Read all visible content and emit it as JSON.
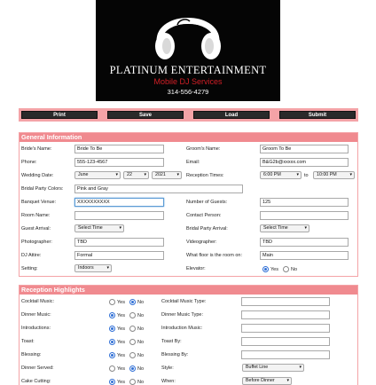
{
  "brand": {
    "name": "PLATINUM ENTERTAINMENT",
    "subtitle": "Mobile DJ Services",
    "phone": "314-556-4279"
  },
  "toolbar": {
    "print": "Print",
    "save": "Save",
    "load": "Load",
    "submit": "Submit"
  },
  "general": {
    "title": "General Information",
    "brides_name_label": "Bride's Name:",
    "brides_name": "Bride To Be",
    "grooms_name_label": "Groom's Name:",
    "grooms_name": "Groom To Be",
    "phone_label": "Phone:",
    "phone": "555-123-4567",
    "email_label": "Email:",
    "email": "B&G2b@xxxxx.com",
    "wedding_date_label": "Wedding Date:",
    "wedding_month": "June",
    "wedding_day": "22",
    "wedding_year": "2021",
    "reception_times_label": "Reception Times:",
    "reception_start": "6:00 PM",
    "to_label": "to",
    "reception_end": "10:00 PM",
    "party_colors_label": "Bridal Party Colors:",
    "party_colors": "Pink and Gray",
    "banquet_venue_label": "Banquet Venue:",
    "banquet_venue": "XXXXXXXXXX",
    "guests_label": "Number of Guests:",
    "guests": "125",
    "room_name_label": "Room Name:",
    "room_name": "",
    "contact_person_label": "Contact Person:",
    "contact_person": "",
    "guest_arrival_label": "Guest Arrival:",
    "guest_arrival": "Select Time",
    "bridal_arrival_label": "Bridal Party Arrival:",
    "bridal_arrival": "Select Time",
    "photographer_label": "Photographer:",
    "photographer": "TBD",
    "videographer_label": "Videographer:",
    "videographer": "TBD",
    "dj_attire_label": "DJ Attire:",
    "dj_attire": "Formal",
    "floor_label": "What floor is the room on:",
    "floor": "Main",
    "setting_label": "Setting:",
    "setting": "Indoors",
    "elevator_label": "Elevator:",
    "yes_label": "Yes",
    "no_label": "No",
    "elevator_selected": "Yes"
  },
  "reception": {
    "title": "Reception Highlights",
    "yes_label": "Yes",
    "no_label": "No",
    "left_items": [
      {
        "label": "Cocktail Music:",
        "selected": "No"
      },
      {
        "label": "Dinner Music:",
        "selected": "Yes"
      },
      {
        "label": "Introductions:",
        "selected": "Yes"
      },
      {
        "label": "Toast:",
        "selected": "Yes"
      },
      {
        "label": "Blessing:",
        "selected": "Yes"
      },
      {
        "label": "Dinner Served:",
        "selected": "No"
      },
      {
        "label": "Cake Cutting:",
        "selected": "Yes"
      }
    ],
    "right_items": [
      {
        "label": "Cocktail Music Type:",
        "value": ""
      },
      {
        "label": "Dinner Music Type:",
        "value": ""
      },
      {
        "label": "Introduction Music:",
        "value": ""
      },
      {
        "label": "Toast By:",
        "value": ""
      },
      {
        "label": "Blessing By:",
        "value": ""
      },
      {
        "label": "Style:",
        "value": "Buffet Line"
      },
      {
        "label": "When:",
        "value": "Before Dinner"
      }
    ]
  },
  "colors": {
    "accent": "#f08a8f",
    "accent_light": "#f4a3a7",
    "brand_red": "#d21f26",
    "header_bg": "#050505"
  }
}
